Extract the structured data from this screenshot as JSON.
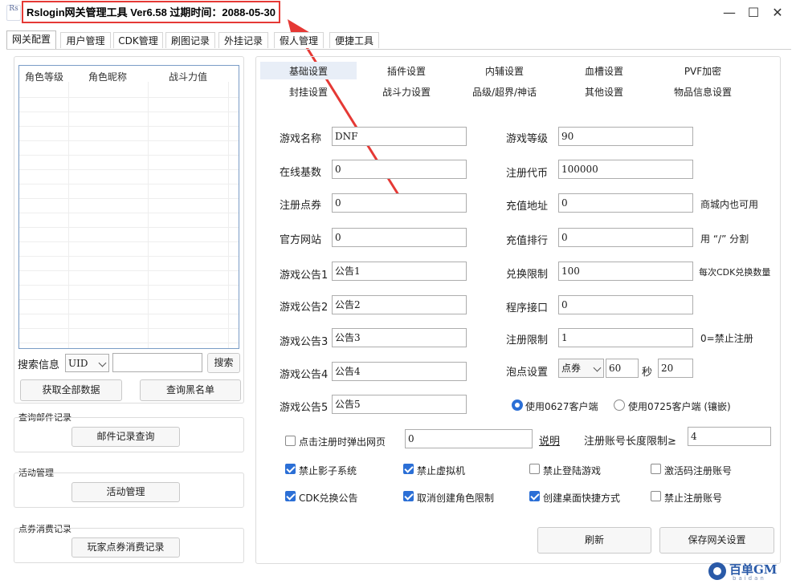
{
  "window": {
    "app_icon_text": "Rs",
    "title": "Rslogin网关管理工具  Ver6.58  过期时间：2088-05-30",
    "minimize": "—",
    "maximize": "☐",
    "close": "✕",
    "annotation_color": "#e53935"
  },
  "tabs": [
    "网关配置",
    "用户管理",
    "CDK管理",
    "刷图记录",
    "外挂记录",
    "假人管理",
    "便捷工具"
  ],
  "left": {
    "grid_headers": [
      "角色等级",
      "角色昵称",
      "战斗力值"
    ],
    "search_label": "搜索信息",
    "search_type": "UID",
    "search_value": "",
    "search_button": "搜索",
    "fetch_all_button": "获取全部数据",
    "blacklist_button": "查询黑名单",
    "mail_section": "查询邮件记录",
    "mail_button": "邮件记录查询",
    "activity_section": "活动管理",
    "activity_button": "活动管理",
    "points_section": "点券消费记录",
    "points_button": "玩家点券消费记录"
  },
  "subtabs": {
    "row1": [
      "基础设置",
      "插件设置",
      "内辅设置",
      "血槽设置",
      "PVF加密"
    ],
    "row2": [
      "封挂设置",
      "战斗力设置",
      "品级/超界/神话",
      "其他设置",
      "物品信息设置"
    ],
    "active": "基础设置"
  },
  "form_left": [
    {
      "label": "游戏名称",
      "value": "DNF"
    },
    {
      "label": "在线基数",
      "value": "0"
    },
    {
      "label": "注册点券",
      "value": "0"
    },
    {
      "label": "官方网站",
      "value": "0"
    },
    {
      "label": "游戏公告1",
      "value": "公告1"
    },
    {
      "label": "游戏公告2",
      "value": "公告2"
    },
    {
      "label": "游戏公告3",
      "value": "公告3"
    },
    {
      "label": "游戏公告4",
      "value": "公告4"
    },
    {
      "label": "游戏公告5",
      "value": "公告5"
    }
  ],
  "form_right": [
    {
      "label": "游戏等级",
      "value": "90",
      "note": ""
    },
    {
      "label": "注册代币",
      "value": "100000",
      "note": ""
    },
    {
      "label": "充值地址",
      "value": "0",
      "note": "商城内也可用"
    },
    {
      "label": "充值排行",
      "value": "0",
      "note": "用 “/” 分割"
    },
    {
      "label": "兑换限制",
      "value": "100",
      "note": "每次CDK兑换数量"
    },
    {
      "label": "程序接口",
      "value": "0",
      "note": ""
    },
    {
      "label": "注册限制",
      "value": "1",
      "note": "0=禁止注册"
    }
  ],
  "bubble": {
    "label": "泡点设置",
    "currency": "点券",
    "interval": "60",
    "unit": "秒",
    "amount": "20"
  },
  "client_radio": {
    "option1": "使用0627客户端",
    "option2": "使用0725客户端 (镶嵌)",
    "selected": "option1"
  },
  "popup_web": {
    "label": "点击注册时弹出网页",
    "value": "0",
    "checked": false,
    "explain": "说明"
  },
  "account_len": {
    "label": "注册账号长度限制≥",
    "value": "4"
  },
  "checkboxes": [
    {
      "label": "禁止影子系统",
      "checked": true
    },
    {
      "label": "禁止虚拟机",
      "checked": true
    },
    {
      "label": "禁止登陆游戏",
      "checked": false
    },
    {
      "label": "激活码注册账号",
      "checked": false
    },
    {
      "label": "CDK兑换公告",
      "checked": true
    },
    {
      "label": "取消创建角色限制",
      "checked": true
    },
    {
      "label": "创建桌面快捷方式",
      "checked": true
    },
    {
      "label": "禁止注册账号",
      "checked": false
    }
  ],
  "actions": {
    "refresh": "刷新",
    "save": "保存网关设置"
  },
  "watermark": "百单GM",
  "watermark_sub": "baidan"
}
